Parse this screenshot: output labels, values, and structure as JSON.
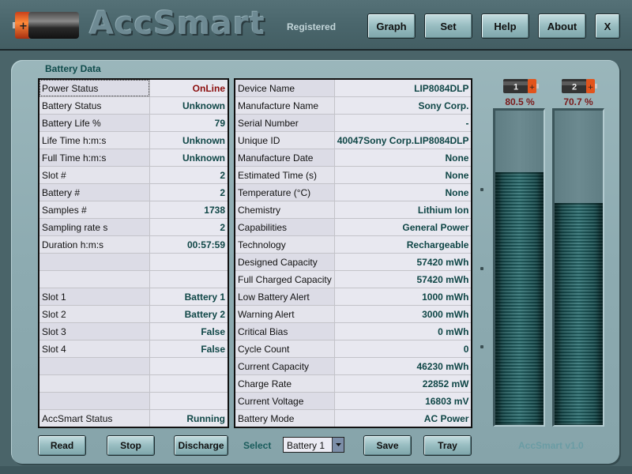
{
  "header": {
    "title": "AccSmart",
    "registration": "Registered",
    "buttons": {
      "graph": "Graph",
      "set": "Set",
      "help": "Help",
      "about": "About",
      "close": "X"
    }
  },
  "battery_data": {
    "title": "Battery Data",
    "left": [
      {
        "label": "Power Status",
        "value": "OnLine",
        "highlight": "red"
      },
      {
        "label": "Battery Status",
        "value": "Unknown"
      },
      {
        "label": "Battery Life %",
        "value": "79"
      },
      {
        "label": "Life Time h:m:s",
        "value": "Unknown"
      },
      {
        "label": "Full Time h:m:s",
        "value": "Unknown"
      },
      {
        "label": "Slot #",
        "value": "2"
      },
      {
        "label": "Battery #",
        "value": "2"
      },
      {
        "label": "Samples #",
        "value": "1738"
      },
      {
        "label": "Sampling rate s",
        "value": "2"
      },
      {
        "label": "Duration h:m:s",
        "value": "00:57:59"
      },
      {
        "label": "",
        "value": ""
      },
      {
        "label": "",
        "value": ""
      },
      {
        "label": "Slot 1",
        "value": "Battery 1"
      },
      {
        "label": "Slot 2",
        "value": "Battery 2"
      },
      {
        "label": "Slot 3",
        "value": "False"
      },
      {
        "label": "Slot 4",
        "value": "False"
      },
      {
        "label": "",
        "value": ""
      },
      {
        "label": "",
        "value": ""
      },
      {
        "label": "",
        "value": ""
      },
      {
        "label": "AccSmart Status",
        "value": "Running"
      }
    ],
    "right": [
      {
        "label": "Device Name",
        "value": "LIP8084DLP"
      },
      {
        "label": "Manufacture Name",
        "value": "Sony Corp."
      },
      {
        "label": "Serial Number",
        "value": "-"
      },
      {
        "label": "Unique ID",
        "value": "40047Sony Corp.LIP8084DLP"
      },
      {
        "label": "Manufacture Date",
        "value": "None"
      },
      {
        "label": "Estimated Time (s)",
        "value": "None"
      },
      {
        "label": "Temperature (°C)",
        "value": "None"
      },
      {
        "label": "Chemistry",
        "value": "Lithium Ion"
      },
      {
        "label": "Capabilities",
        "value": "General Power"
      },
      {
        "label": "Technology",
        "value": "Rechargeable"
      },
      {
        "label": "Designed Capacity",
        "value": "57420 mWh"
      },
      {
        "label": "Full Charged Capacity",
        "value": "57420 mWh"
      },
      {
        "label": "Low Battery Alert",
        "value": "1000 mWh"
      },
      {
        "label": "Warning Alert",
        "value": "3000 mWh"
      },
      {
        "label": "Critical Bias",
        "value": "0 mWh"
      },
      {
        "label": "Cycle Count",
        "value": "0"
      },
      {
        "label": "Current Capacity",
        "value": "46230 mWh"
      },
      {
        "label": "Charge Rate",
        "value": "22852 mW"
      },
      {
        "label": "Current Voltage",
        "value": "16803 mV"
      },
      {
        "label": "Battery Mode",
        "value": "AC Power"
      }
    ]
  },
  "meters": [
    {
      "id": "1",
      "label": "80.5 %",
      "level_percent": 80.5
    },
    {
      "id": "2",
      "label": "70.7 %",
      "level_percent": 70.7
    }
  ],
  "footer": {
    "buttons": {
      "read": "Read",
      "stop": "Stop",
      "discharge": "Discharge",
      "save": "Save",
      "tray": "Tray"
    },
    "select_label": "Select",
    "select_value": "Battery 1",
    "version": "AccSmart v1.0"
  },
  "colors": {
    "accent": "#0f4646",
    "alert": "#8b0e0e",
    "battery_cap": "#e2541c"
  }
}
